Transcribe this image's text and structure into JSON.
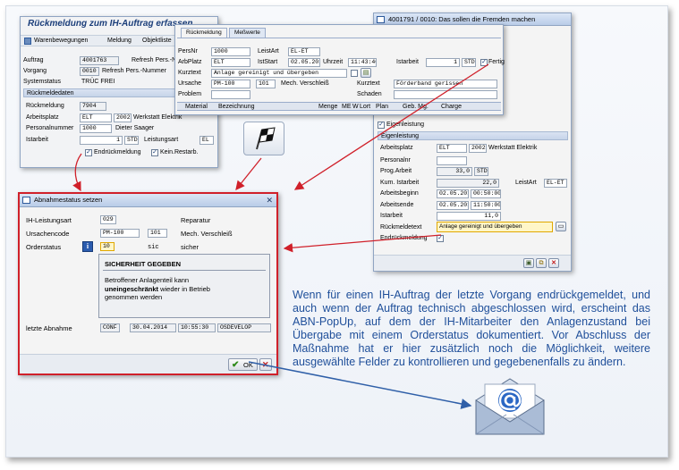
{
  "rueckmeldung": {
    "title": "Rückmeldung zum IH-Auftrag erfassen",
    "toolbar": [
      "Warenbewegungen",
      "Meldung",
      "Objektliste"
    ],
    "auftrag_label": "Auftrag",
    "auftrag": "4001763",
    "auftrag_text": "Refresh Pers.-N",
    "vorgang_label": "Vorgang",
    "vorgang": "0010",
    "vorgang_text": "Refresh Pers.-Nummer",
    "systemstatus_label": "Systemstatus",
    "systemstatus": "TRÜC FREI",
    "group": "Rückmeldedaten",
    "rueckmeldung_label": "Rückmeldung",
    "rueckmeldung": "7904",
    "arbeitsplatz_label": "Arbeitsplatz",
    "arbeitsplatz": "ELT",
    "werk": "2002",
    "arbeitsplatz_text": "Werkstatt Elektrik",
    "personalnummer_label": "Personalnummer",
    "personalnummer": "1000",
    "person_name": "Dieter Saager",
    "istarbeit_label": "Istarbeit",
    "istarbeit": "1",
    "istarbeit_unit": "STD",
    "leistungsart_label": "Leistungsart",
    "leistungsart": "EL",
    "endrueck_label": "Endrückmeldung",
    "keinrest_label": "Kein.Restarb."
  },
  "table_window": {
    "tabs": [
      "Rückmeldung",
      "Meßwerte"
    ],
    "persnr_label": "PersNr",
    "persnr": "1000",
    "leistart_label": "LeistArt",
    "leistart": "EL-ET",
    "arbplatz_label": "ArbPlatz",
    "arbplatz": "ELT",
    "iststart_label": "IstStart",
    "iststart": "02.05.2014",
    "uhrzeit_label": "Uhrzeit",
    "uhrzeit": "11:43:40",
    "istarbeit_label": "Istarbeit",
    "istarbeit": "1",
    "istarbeit_unit": "STD",
    "fertig_label": "Fertig",
    "kurztext_label": "Kurztext",
    "kurztext": "Anlage gereinigt und übergeben",
    "ursache_label": "Ursache",
    "ursache": "PM-100",
    "ursache_num": "101",
    "ursache_text": "Mech. Verschleiß",
    "kurztext2_label": "Kurztext",
    "kurztext2": "Förderband gerissen",
    "problem_label": "Problem",
    "schaden_label": "Schaden",
    "columns": [
      "Material",
      "Bezeichnung",
      "Menge",
      "ME",
      "W",
      "Lort",
      "Plan",
      "Geb. Mg.",
      "Charge"
    ]
  },
  "detail_window": {
    "title": "4001791 / 0010:  Das sollen die Fremden machen",
    "check_eigenleistung": "Eigenleistung",
    "group": "Eigenleistung",
    "arbeitsplatz_label": "Arbeitsplatz",
    "arbeitsplatz": "ELT",
    "werk": "2002",
    "arbeitsplatz_text": "Werkstatt Elektrik",
    "personalnr_label": "Personalnr",
    "prog_label": "Prog.Arbeit",
    "prog": "33,0",
    "prog_unit": "STD",
    "kum_label": "Kum. Istarbeit",
    "kum": "22,0",
    "leistart_label": "LeistArt",
    "leistart": "EL-ET",
    "beginn_label": "Arbeitsbeginn",
    "beginn_date": "02.05.2014",
    "beginn_time": "00:50:00",
    "ende_label": "Arbeitsende",
    "ende_date": "02.05.2014",
    "ende_time": "11:50:00",
    "istarbeit_label": "Istarbeit",
    "istarbeit": "11,0",
    "rueckmeldetext_label": "Rückmeldetext",
    "rueckmeldetext": "Anlage gereinigt und übergeben",
    "endrueck_label": "Endrückmeldung"
  },
  "abnahme": {
    "title": "Abnahmestatus setzen",
    "ih_label": "IH-Leistungsart",
    "ih": "029",
    "ih_text": "Reparatur",
    "ursache_label": "Ursachencode",
    "ursache": "PM-100",
    "ursache_num": "101",
    "ursache_text": "Mech. Verschleiß",
    "orderstatus_label": "Orderstatus",
    "orderstatus": "10",
    "status_code": "sic",
    "status_text": "sicher",
    "info_title": "SICHERHEIT GEGEBEN",
    "info_line1": "Betroffener Anlagenteil kann",
    "info_bold": "uneingeschränkt",
    "info_line2": " wieder in Betrieb",
    "info_line3": "genommen werden",
    "letzte_label": "letzte Abnahme",
    "letzte_status": "CONF",
    "letzte_date": "30.04.2014",
    "letzte_time": "10:55:30",
    "letzte_user": "OSDEVELOP",
    "ok_label": "OK"
  },
  "description": "Wenn für einen IH-Auftrag der letzte Vorgang endrückgemeldet, und auch wenn der Auftrag technisch abgeschlossen wird, erscheint das ABN-PopUp, auf dem der IH-Mitarbeiter den Anlagenzustand bei Übergabe mit einem Orderstatus dokumentiert. Vor Abschluss der Maßnahme hat er hier zusätzlich noch die Möglichkeit, weitere ausgewählte Felder zu kontrollieren und gegebenenfalls zu ändern.",
  "colors": {
    "accent_red": "#d0202a",
    "arrow_blue": "#2f5fa8",
    "text_blue": "#1f4f9a"
  }
}
